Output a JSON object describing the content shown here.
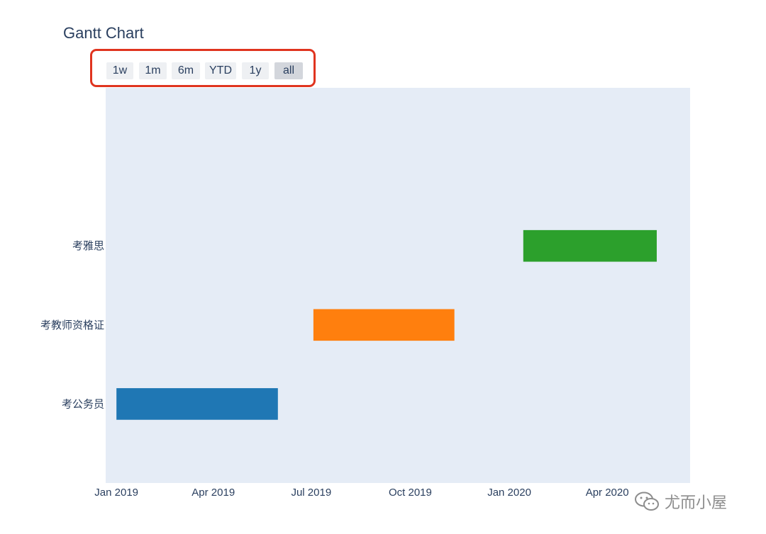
{
  "chart_data": {
    "type": "gantt",
    "title": "Gantt Chart",
    "range_buttons": [
      {
        "label": "1w",
        "active": false
      },
      {
        "label": "1m",
        "active": false
      },
      {
        "label": "6m",
        "active": false
      },
      {
        "label": "YTD",
        "active": false
      },
      {
        "label": "1y",
        "active": false
      },
      {
        "label": "all",
        "active": true
      }
    ],
    "tasks": [
      {
        "task": "考公务员",
        "start": "2019-01-01",
        "finish": "2019-05-31",
        "color": "#1f77b4"
      },
      {
        "task": "考教师资格证",
        "start": "2019-07-03",
        "finish": "2019-11-11",
        "color": "#ff7f0e"
      },
      {
        "task": "考雅思",
        "start": "2020-01-14",
        "finish": "2020-05-17",
        "color": "#2ca02c"
      }
    ],
    "x_ticks": [
      "Jan 2019",
      "Apr 2019",
      "Jul 2019",
      "Oct 2019",
      "Jan 2020",
      "Apr 2020"
    ],
    "xlim": [
      "2018-12-22",
      "2020-06-17"
    ],
    "plot_bgcolor": "#e5ecf6",
    "grid": false
  },
  "watermark": "尤而小屋"
}
